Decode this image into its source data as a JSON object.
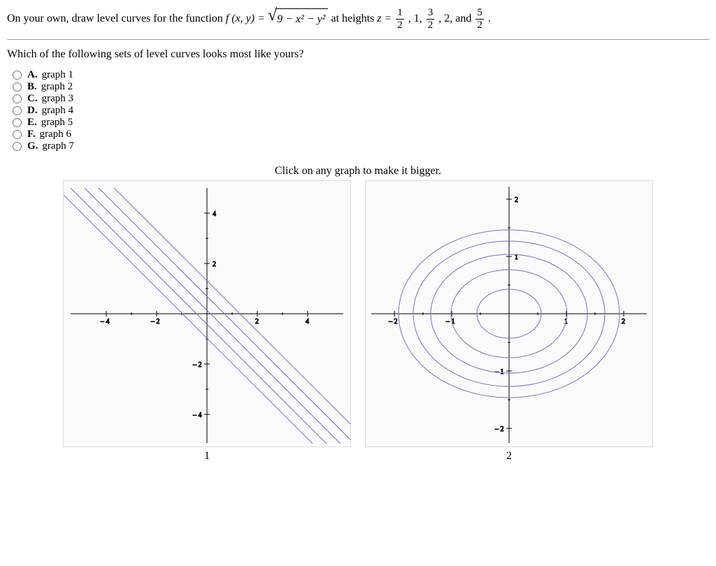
{
  "question": {
    "intro": "On your own, draw level curves for the function ",
    "fn_lhs": "f (x, y) = ",
    "radicand": "9 − x² − y²",
    "heights_pre": " at heights ",
    "heights_var": "z = ",
    "heights_tail1": ", 1, ",
    "heights_tail2": ", 2, and ",
    "heights_end": "."
  },
  "fractions": {
    "half": {
      "num": "1",
      "den": "2"
    },
    "threehalf": {
      "num": "3",
      "den": "2"
    },
    "fivehalf": {
      "num": "5",
      "den": "2"
    }
  },
  "subquestion": "Which of the following sets of level curves looks most like yours?",
  "options": [
    {
      "letter": "A.",
      "label": "graph 1"
    },
    {
      "letter": "B.",
      "label": "graph 2"
    },
    {
      "letter": "C.",
      "label": "graph 3"
    },
    {
      "letter": "D.",
      "label": "graph 4"
    },
    {
      "letter": "E.",
      "label": "graph 5"
    },
    {
      "letter": "F.",
      "label": "graph 6"
    },
    {
      "letter": "G.",
      "label": "graph 7"
    }
  ],
  "click_hint": "Click on any graph to make it bigger.",
  "graph_labels": {
    "one": "1",
    "two": "2"
  },
  "chart_data": [
    {
      "type": "line",
      "title": "",
      "axes": {
        "xrange": [
          -5,
          5
        ],
        "yrange": [
          -5,
          5
        ],
        "xticks": [
          -4,
          -2,
          2,
          4
        ],
        "yticks": [
          -4,
          -2,
          2,
          4
        ]
      },
      "series": [
        {
          "name": "line1",
          "a": -1,
          "b": 0.4
        },
        {
          "name": "line2",
          "a": -1,
          "b": 0.8
        },
        {
          "name": "line3",
          "a": -1,
          "b": 1.2
        },
        {
          "name": "line4",
          "a": -1,
          "b": 1.6
        },
        {
          "name": "line5",
          "a": -1,
          "b": 2.0
        }
      ],
      "note": "diagonal parallel lines y = -x + b (approx)"
    },
    {
      "type": "ellipse-contour",
      "title": "",
      "axes": {
        "xrange": [
          -2.3,
          2.3
        ],
        "yrange": [
          -2.3,
          2.3
        ],
        "xticks": [
          -2,
          -1,
          1,
          2
        ],
        "yticks": [
          -2,
          -1,
          1,
          2
        ]
      },
      "series": [
        {
          "rx": 1.9,
          "ry": 1.45
        },
        {
          "rx": 1.65,
          "ry": 1.25
        },
        {
          "rx": 1.35,
          "ry": 1.0
        },
        {
          "rx": 1.0,
          "ry": 0.75
        },
        {
          "rx": 0.55,
          "ry": 0.4
        }
      ],
      "note": "concentric ellipses centered at origin"
    }
  ]
}
